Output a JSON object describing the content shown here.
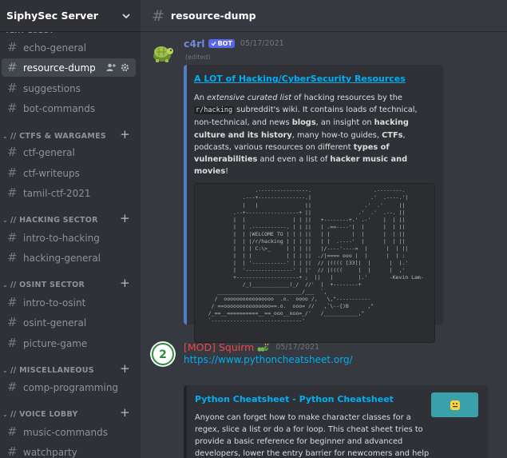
{
  "server": {
    "name": "SiphySec Server"
  },
  "sidebar": {
    "partial_category": "TEXT LOBBY",
    "channels_top": [
      {
        "name": "echo-general"
      },
      {
        "name": "resource-dump",
        "active": true
      },
      {
        "name": "suggestions"
      },
      {
        "name": "bot-commands"
      }
    ],
    "categories": [
      {
        "name": "// CTFS & WARGAMES",
        "channels": [
          "ctf-general",
          "ctf-writeups",
          "tamil-ctf-2021"
        ]
      },
      {
        "name": "// HACKING SECTOR",
        "channels": [
          "intro-to-hacking",
          "hacking-general"
        ]
      },
      {
        "name": "// OSINT SECTOR",
        "channels": [
          "intro-to-osint",
          "osint-general",
          "picture-game"
        ]
      },
      {
        "name": "// MISCELLANEOUS",
        "channels": [
          "comp-programming"
        ]
      },
      {
        "name": "// VOICE LOBBY",
        "channels": [
          "music-commands",
          "watchparty"
        ]
      }
    ]
  },
  "channel": {
    "name": "resource-dump"
  },
  "messages": [
    {
      "author": "c4rl",
      "author_color": "#7289da",
      "bot_label": "BOT",
      "timestamp": "05/17/2021",
      "edited": "(edited)",
      "embed": {
        "title": "A LOT of Hacking/CyberSecurity Resources",
        "desc": {
          "p1": "An ",
          "em1": "extensive curated list",
          "p2": " of hacking resources by the ",
          "code1": "r/hacking",
          "p3": " subreddit's wiki. It contains loads of technical, non-technical, and news ",
          "b1": "blogs",
          "p4": ", an insight on ",
          "b2": "hacking culture and its history",
          "p5": ", many how-to guides, ",
          "b3": "CTFs",
          "p6": ", podcasts, various resources on different ",
          "b4": "types of vulnerabilities",
          "p7": " and even a list of ",
          "b5": "hacker music and movies",
          "p8": "!"
        },
        "ascii_art": "                  .----------------.                    .--------.\n              .---+---------------.|                   .'  .----.'|\n              |   |               ||                 .'  .'     ||\n           .--+-----------------+ ||               .'  .'  .--. ||\n           |  |               | | ||   +--------+.' .-'    |  | ||\n           |  | .-----------. | | ||   | .==----'|  |      |  | ||\n           |  | |WELCOME TO | | | ||   | |       |  |      |  | ||\n           |  | |/r/hacking | | | ||   | |  .----'  |      |  | ||\n           |  | | C:\\>_     | | | ||   |/----'----=  |      |  | ||\n           |  | |           | | | ||  ./|==== ooo |  |      |  | :\n           |  | '-----------' | | ||  // |(((( [33]|  |      |  |.'\n           |  '---------------' | |'  // |((((     |  |      |  ,'\n           +--------------------+ ;  ||   |        |.'       -Kevin Lam-\n              /_)____________(_/  //'  |  +--------+\n      ___________________________/___  `,\n     /  oooooooooooooooo  .o.  oooo /,   \\,\"-----------\n    / ==ooooooooooooooo==.o.  ooo= //   ,`\\--{)B      ,\"\n   /_==__==========__==_ooo__ooo=_/'   /___________,\"\n   `-----------------------------'"
      }
    },
    {
      "author": "[MOD] Squirm",
      "author_color": "#f04747",
      "timestamp": "05/17/2021",
      "link": "https://www.pythoncheatsheet.org/",
      "embed": {
        "title": "Python Cheatsheet - Python Cheatsheet",
        "desc": "Anyone can forget how to make character classes for a regex, slice a list or do a for loop. This cheat sheet tries to provide a basic reference for beginner and advanced developers, lower the entry barrier for newcomers and help veterans refresh the old tricks."
      }
    }
  ],
  "colors": {
    "sidebar_bg": "#2f3136",
    "main_bg": "#36393f",
    "link": "#00aff4",
    "bot_tag": "#5865f2",
    "embed_border": "#4f7fc3"
  }
}
